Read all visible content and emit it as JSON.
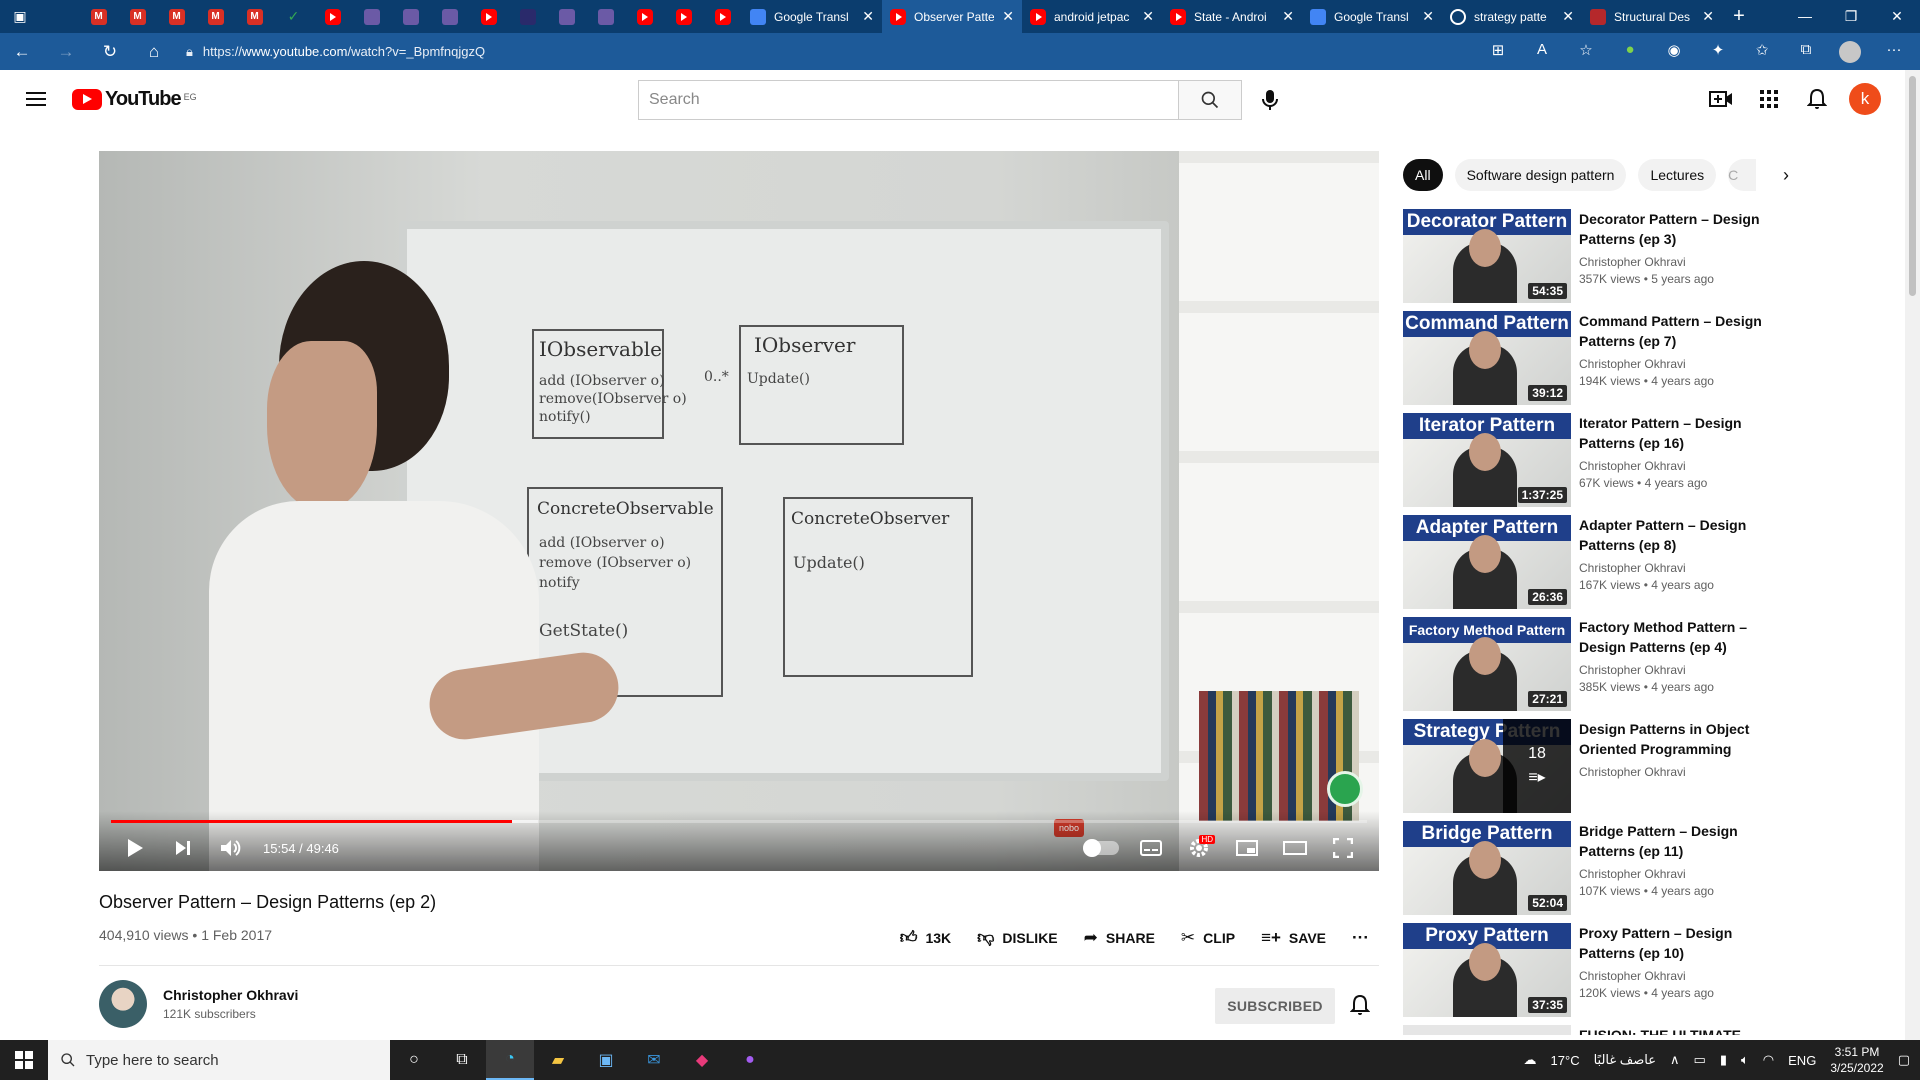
{
  "browser": {
    "pinned_tabs": [
      {
        "icon": "app-icon"
      },
      {
        "icon": "gmail-icon"
      },
      {
        "icon": "gmail-icon"
      },
      {
        "icon": "gmail-icon"
      },
      {
        "icon": "gmail-icon"
      },
      {
        "icon": "gmail-icon"
      },
      {
        "icon": "check-icon"
      },
      {
        "icon": "youtube-icon"
      },
      {
        "icon": "misc-icon"
      },
      {
        "icon": "misc-icon"
      },
      {
        "icon": "misc-icon"
      },
      {
        "icon": "youtube-icon"
      },
      {
        "icon": "blank-icon"
      },
      {
        "icon": "misc-icon"
      },
      {
        "icon": "misc-icon"
      },
      {
        "icon": "youtube-icon"
      },
      {
        "icon": "youtube-icon"
      },
      {
        "icon": "youtube-icon"
      }
    ],
    "tabs": [
      {
        "title": "Google Transl",
        "icon": "google-translate-icon",
        "active": false
      },
      {
        "title": "Observer Patte",
        "icon": "youtube-icon",
        "active": true
      },
      {
        "title": "android jetpac",
        "icon": "youtube-icon",
        "active": false
      },
      {
        "title": "State - Androi",
        "icon": "youtube-icon",
        "active": false
      },
      {
        "title": "Google Transl",
        "icon": "google-translate-icon",
        "active": false
      },
      {
        "title": "strategy patte",
        "icon": "google-icon",
        "active": false
      },
      {
        "title": "Structural Des",
        "icon": "bookmark-icon",
        "active": false
      }
    ],
    "url_prefix": "https://",
    "url_host": "www.youtube.com",
    "url_path": "/watch?v=_BpmfnqjgzQ"
  },
  "youtube": {
    "logo_text": "YouTube",
    "country_code": "EG",
    "search_placeholder": "Search",
    "avatar_letter": "k"
  },
  "player": {
    "current_time": "15:54",
    "duration": "49:46",
    "time_display": "15:54 / 49:46",
    "progress_fraction": 0.3195,
    "buffered_fraction": 0.34,
    "whiteboard": {
      "box1_title": "IObservable",
      "box1_lines": [
        "add (IObserver o)",
        "remove(IObserver o)",
        "notify()"
      ],
      "box2_title": "IObserver",
      "box2_lines": [
        "Update()"
      ],
      "multiplicity": "0..*",
      "box3_title": "ConcreteObservable",
      "box3_lines": [
        "add (IObserver o)",
        "remove (IObserver o)",
        "notify",
        "GetState()"
      ],
      "box4_title": "ConcreteObserver",
      "box4_lines": [
        "Update()"
      ]
    },
    "nobo_label": "nobo",
    "hd_badge": "HD"
  },
  "video": {
    "title": "Observer Pattern – Design Patterns (ep 2)",
    "views": "404,910 views",
    "date": "1 Feb 2017",
    "likes": "13K",
    "dislike_label": "DISLIKE",
    "share_label": "SHARE",
    "clip_label": "CLIP",
    "save_label": "SAVE",
    "channel_name": "Christopher Okhravi",
    "subscribers": "121K subscribers",
    "subscribed_label": "SUBSCRIBED"
  },
  "chips": [
    "All",
    "Software design pattern",
    "Lectures",
    "C"
  ],
  "recommendations": [
    {
      "banner": "Decorator Pattern",
      "title": "Decorator Pattern – Design Patterns (ep 3)",
      "channel": "Christopher Okhravi",
      "views": "357K views",
      "age": "5 years ago",
      "duration": "54:35"
    },
    {
      "banner": "Command Pattern",
      "title": "Command Pattern – Design Patterns (ep 7)",
      "channel": "Christopher Okhravi",
      "views": "194K views",
      "age": "4 years ago",
      "duration": "39:12"
    },
    {
      "banner": "Iterator Pattern",
      "title": "Iterator Pattern – Design Patterns (ep 16)",
      "channel": "Christopher Okhravi",
      "views": "67K views",
      "age": "4 years ago",
      "duration": "1:37:25"
    },
    {
      "banner": "Adapter Pattern",
      "title": "Adapter Pattern – Design Patterns (ep 8)",
      "channel": "Christopher Okhravi",
      "views": "167K views",
      "age": "4 years ago",
      "duration": "26:36"
    },
    {
      "banner": "Factory Method Pattern",
      "title": "Factory Method Pattern – Design Patterns (ep 4)",
      "channel": "Christopher Okhravi",
      "views": "385K views",
      "age": "4 years ago",
      "duration": "27:21"
    },
    {
      "banner": "Strategy Pattern",
      "title": "Design Patterns in Object Oriented Programming",
      "channel": "Christopher Okhravi",
      "views": "",
      "age": "",
      "duration": "",
      "playlist_count": "18"
    },
    {
      "banner": "Bridge Pattern",
      "title": "Bridge Pattern – Design Patterns (ep 11)",
      "channel": "Christopher Okhravi",
      "views": "107K views",
      "age": "4 years ago",
      "duration": "52:04"
    },
    {
      "banner": "Proxy Pattern",
      "title": "Proxy Pattern – Design Patterns (ep 10)",
      "channel": "Christopher Okhravi",
      "views": "120K views",
      "age": "4 years ago",
      "duration": "37:35"
    },
    {
      "banner": "",
      "title": "FUSION: THE ULTIMATE",
      "channel": "",
      "views": "",
      "age": "",
      "duration": ""
    }
  ],
  "taskbar": {
    "search_placeholder": "Type here to search",
    "weather": "17°C",
    "weather_text": "عاصف غالبًا",
    "language": "ENG",
    "time": "3:51 PM",
    "date": "3/25/2022"
  },
  "colors": {
    "browser_tabbar": "#0b3d6e",
    "browser_addressbar": "#1d5a99",
    "youtube_red": "#ff0000",
    "progress_red": "#ff0000",
    "banner_blue": "#1f3f8a",
    "avatar_orange": "#ef4c1a"
  }
}
